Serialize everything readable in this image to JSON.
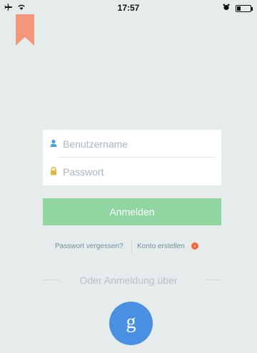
{
  "status_bar": {
    "time": "17:57",
    "icons": [
      "airplane-icon",
      "wifi-icon",
      "alarm-icon",
      "battery-icon"
    ],
    "battery_level": 0.25
  },
  "bookmark": {
    "icon": "bookmark-icon",
    "color": "#f4967a"
  },
  "login": {
    "username_placeholder": "Benutzername",
    "password_placeholder": "Passwort",
    "username_icon": "user-icon",
    "password_icon": "lock-icon",
    "submit_label": "Anmelden",
    "accent_color": "#8fd6a2"
  },
  "links": {
    "forgot_password": "Passwort vergessen?",
    "create_account": "Konto erstellen",
    "create_icon": "chevron-right-icon"
  },
  "alternative": {
    "label": "Oder Anmeldung über",
    "google_label": "g",
    "google_color": "#4a90e2"
  }
}
